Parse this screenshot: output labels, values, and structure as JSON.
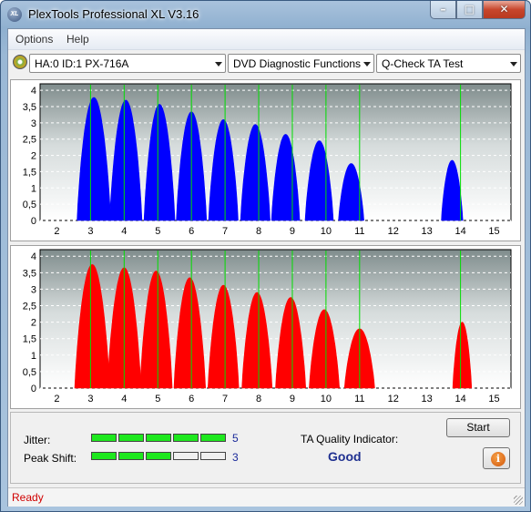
{
  "window": {
    "title": "PlexTools Professional XL V3.16",
    "logo_text": "XL",
    "minimize_glyph": "–",
    "maximize_glyph": "□",
    "close_glyph": "✕"
  },
  "menu": [
    "Options",
    "Help"
  ],
  "toolbar": {
    "drive": "HA:0 ID:1  PX-716A",
    "function": "DVD Diagnostic Functions",
    "test": "Q-Check TA Test"
  },
  "results": {
    "jitter_label": "Jitter:",
    "jitter_value": "5",
    "jitter_level": 5,
    "peak_label": "Peak Shift:",
    "peak_value": "3",
    "peak_level": 3,
    "ta_label": "TA Quality Indicator:",
    "ta_value": "Good",
    "start_label": "Start",
    "info_glyph": "i"
  },
  "status": {
    "text": "Ready"
  },
  "colors": {
    "land_series": "#0000ff",
    "pit_series": "#ff0000",
    "marker_lines": "#00dd00",
    "plot_background": "#c8d0d0"
  },
  "chart_data": [
    {
      "type": "area",
      "name": "",
      "color": "#0000ff",
      "x_ticks": [
        2,
        3,
        4,
        5,
        6,
        7,
        8,
        9,
        10,
        11,
        12,
        13,
        14,
        15
      ],
      "y_ticks": [
        "0",
        "0,5",
        "1",
        "1,5",
        "2",
        "2,5",
        "3",
        "3,5",
        "4"
      ],
      "xlim": [
        1.5,
        15.5
      ],
      "ylim": [
        0,
        4.2
      ],
      "markers": [
        3,
        4,
        5,
        6,
        7,
        8,
        9,
        10,
        11,
        14
      ],
      "peaks": [
        {
          "center": 3.1,
          "height": 3.78,
          "width": 0.5
        },
        {
          "center": 4.05,
          "height": 3.7,
          "width": 0.48
        },
        {
          "center": 5.05,
          "height": 3.57,
          "width": 0.46
        },
        {
          "center": 6.0,
          "height": 3.34,
          "width": 0.45
        },
        {
          "center": 6.95,
          "height": 3.1,
          "width": 0.44
        },
        {
          "center": 7.9,
          "height": 2.95,
          "width": 0.44
        },
        {
          "center": 8.8,
          "height": 2.65,
          "width": 0.42
        },
        {
          "center": 9.8,
          "height": 2.45,
          "width": 0.42
        },
        {
          "center": 10.75,
          "height": 1.75,
          "width": 0.38
        },
        {
          "center": 13.75,
          "height": 1.85,
          "width": 0.32
        }
      ],
      "grid": true
    },
    {
      "type": "area",
      "name": "",
      "color": "#ff0000",
      "x_ticks": [
        2,
        3,
        4,
        5,
        6,
        7,
        8,
        9,
        10,
        11,
        12,
        13,
        14,
        15
      ],
      "y_ticks": [
        "0",
        "0,5",
        "1",
        "1,5",
        "2",
        "2,5",
        "3",
        "3,5",
        "4"
      ],
      "xlim": [
        1.5,
        15.5
      ],
      "ylim": [
        0,
        4.2
      ],
      "markers": [
        3,
        4,
        5,
        6,
        7,
        8,
        9,
        10,
        11,
        14
      ],
      "peaks": [
        {
          "center": 3.05,
          "height": 3.75,
          "width": 0.52
        },
        {
          "center": 4.0,
          "height": 3.65,
          "width": 0.5
        },
        {
          "center": 4.95,
          "height": 3.55,
          "width": 0.48
        },
        {
          "center": 5.95,
          "height": 3.35,
          "width": 0.47
        },
        {
          "center": 6.95,
          "height": 3.12,
          "width": 0.46
        },
        {
          "center": 7.95,
          "height": 2.9,
          "width": 0.45
        },
        {
          "center": 8.95,
          "height": 2.75,
          "width": 0.45
        },
        {
          "center": 9.95,
          "height": 2.38,
          "width": 0.45
        },
        {
          "center": 11.0,
          "height": 1.8,
          "width": 0.45
        },
        {
          "center": 14.05,
          "height": 2.0,
          "width": 0.28
        }
      ],
      "grid": true
    }
  ]
}
